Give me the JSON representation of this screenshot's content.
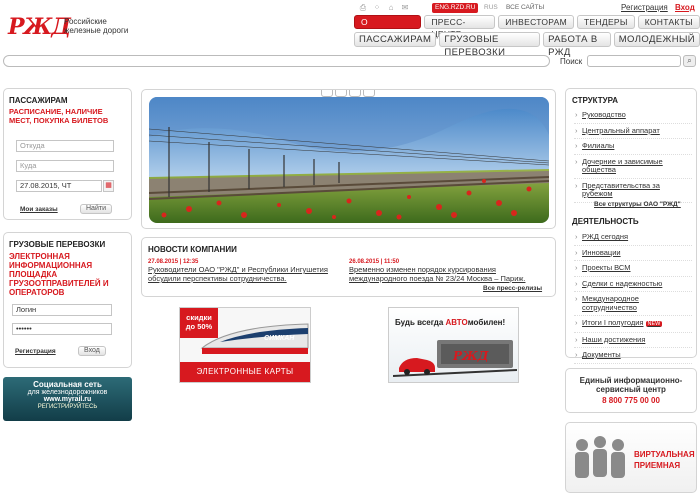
{
  "header": {
    "logo_mark": "РЖД",
    "logo_line1": "Российские",
    "logo_line2": "железные дороги",
    "eng_label": "ENG.RZD.RU",
    "rus_label": "RUS",
    "all_sites": "ВСЕ САЙТЫ",
    "register": "Регистрация",
    "login": "Вход",
    "icons": [
      "print-icon",
      "sitemap-icon",
      "home-icon",
      "mail-icon"
    ]
  },
  "nav_top": [
    "О КОМПАНИИ",
    "ПРЕСС-ЦЕНТР",
    "ИНВЕСТОРАМ",
    "ТЕНДЕРЫ",
    "КОНТАКТЫ"
  ],
  "nav_main": [
    "ПАССАЖИРАМ",
    "ГРУЗОВЫЕ ПЕРЕВОЗКИ",
    "РАБОТА В РЖД",
    "МОЛОДЕЖНЫЙ"
  ],
  "search": {
    "label": "Поиск",
    "placeholder": ""
  },
  "passengers": {
    "title": "ПАССАЖИРАМ",
    "subtitle": "РАСПИСАНИЕ, НАЛИЧИЕ МЕСТ, ПОКУПКА БИЛЕТОВ",
    "from_placeholder": "Откуда",
    "to_placeholder": "Куда",
    "date_value": "27.08.2015, ЧТ",
    "my_orders": "Мои заказы",
    "find_button": "Найти"
  },
  "cargo": {
    "title": "ГРУЗОВЫЕ ПЕРЕВОЗКИ",
    "subtitle": "ЭЛЕКТРОННАЯ ИНФОРМАЦИОННАЯ ПЛОЩАДКА ГРУЗООТПРАВИТЕЛЕЙ И ОПЕРАТОРОВ",
    "login_placeholder": "Логин",
    "password_value": "••••••",
    "register": "Регистрация",
    "login_button": "Вход"
  },
  "social_banner": {
    "line1": "Социальная сеть",
    "line2": "для железнодорожников",
    "site": "www.myrail.ru",
    "cta": "РЕГИСТРИРУЙТЕСЬ"
  },
  "news": {
    "title": "НОВОСТИ КОМПАНИИ",
    "items": [
      {
        "date": "27.08.2015 | 12:35",
        "text": "Руководители ОАО \"РЖД\" и Республики Ингушетия обсудили перспективы сотрудничества."
      },
      {
        "date": "26.08.2015 | 11:50",
        "text": "Временно изменен порядок курсирования международного поезда № 23/24 Москва – Париж."
      }
    ],
    "all_link": "Все пресс-релизы"
  },
  "promo_cards": {
    "discount_line1": "скидки",
    "discount_line2": "до 50%",
    "train_label": "СИМКАН",
    "button": "ЭЛЕКТРОННЫЕ КАРТЫ"
  },
  "promo_auto": {
    "prefix": "Будь всегда ",
    "highlight": "АВТО",
    "suffix": "мобилен!"
  },
  "structure": {
    "title": "СТРУКТУРА",
    "items": [
      "Руководство",
      "Центральный аппарат",
      "Филиалы",
      "Дочерние и зависимые общества",
      "Представительства за рубежом"
    ],
    "all_link": "Все структуры ОАО \"РЖД\""
  },
  "activity": {
    "title": "ДЕЯТЕЛЬНОСТЬ",
    "items": [
      "РЖД сегодня",
      "Инновации",
      "Проекты ВСМ",
      "Сделки с надежностью",
      "Международное сотрудничество",
      "Итоги I полугодия",
      "Наши достижения",
      "Документы"
    ],
    "new_badge": "NEW"
  },
  "service_center": {
    "line1": "Единый информационно-",
    "line2": "сервисный центр",
    "phone": "8 800 775 00 00"
  },
  "virtual_reception": {
    "line1": "ВИРТУАЛЬНАЯ",
    "line2": "ПРИЕМНАЯ"
  },
  "colors": {
    "brand_red": "#d7191f",
    "banner_teal": "#1e5663"
  }
}
